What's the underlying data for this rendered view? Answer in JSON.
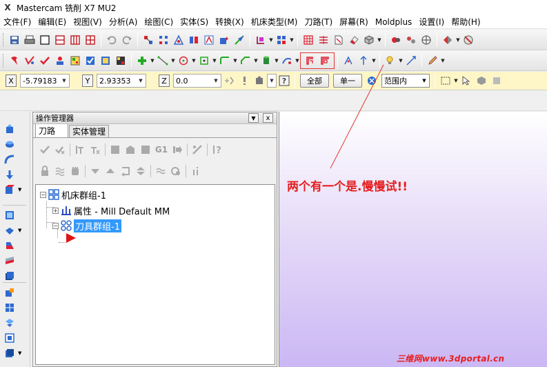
{
  "window": {
    "title": "Mastercam 铣削 X7 MU2"
  },
  "menu": [
    "文件(F)",
    "编辑(E)",
    "视图(V)",
    "分析(A)",
    "绘图(C)",
    "实体(S)",
    "转换(X)",
    "机床类型(M)",
    "刀路(T)",
    "屏幕(R)",
    "Moldplus",
    "设置(I)",
    "帮助(H)"
  ],
  "coords": {
    "x_label": "X",
    "x_value": "-5.79183",
    "y_label": "Y",
    "y_value": "2.93353",
    "z_label": "Z",
    "z_value": "0.0",
    "btn_all": "全部",
    "btn_single": "单一",
    "range_select": "范围内"
  },
  "ops_manager": {
    "title": "操作管理器",
    "close_glyph": "x",
    "tabs": [
      "刀路",
      "实体管理"
    ],
    "tool_labels": {
      "g1": "G1"
    },
    "tree": {
      "machine_group": "机床群组-1",
      "properties": "属性 - Mill Default MM",
      "tool_group": "刀具群组-1"
    }
  },
  "viewport": {
    "annotation": "两个有一个是.慢慢试!!",
    "watermark": "三维网www.3dportal.cn"
  },
  "colors": {
    "annotation": "#e41e1e",
    "highlight_box": "#e23434",
    "selection": "#3399ff",
    "viewport_bottom": "#cbb7f4"
  }
}
